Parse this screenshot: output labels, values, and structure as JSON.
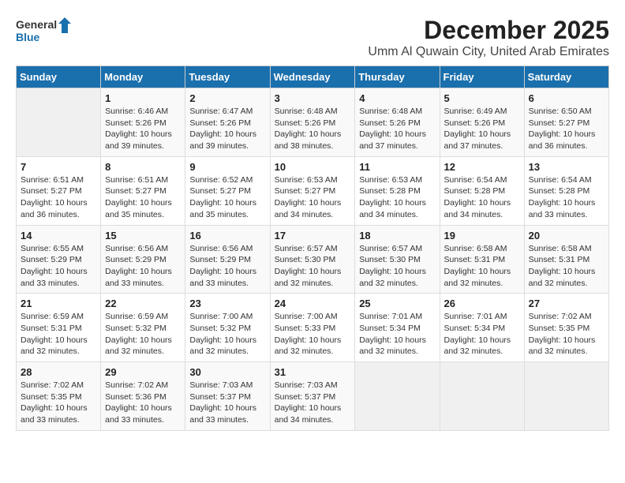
{
  "logo": {
    "general": "General",
    "blue": "Blue"
  },
  "title": "December 2025",
  "subtitle": "Umm Al Quwain City, United Arab Emirates",
  "weekdays": [
    "Sunday",
    "Monday",
    "Tuesday",
    "Wednesday",
    "Thursday",
    "Friday",
    "Saturday"
  ],
  "weeks": [
    [
      {
        "day": "",
        "info": ""
      },
      {
        "day": "1",
        "info": "Sunrise: 6:46 AM\nSunset: 5:26 PM\nDaylight: 10 hours\nand 39 minutes."
      },
      {
        "day": "2",
        "info": "Sunrise: 6:47 AM\nSunset: 5:26 PM\nDaylight: 10 hours\nand 39 minutes."
      },
      {
        "day": "3",
        "info": "Sunrise: 6:48 AM\nSunset: 5:26 PM\nDaylight: 10 hours\nand 38 minutes."
      },
      {
        "day": "4",
        "info": "Sunrise: 6:48 AM\nSunset: 5:26 PM\nDaylight: 10 hours\nand 37 minutes."
      },
      {
        "day": "5",
        "info": "Sunrise: 6:49 AM\nSunset: 5:26 PM\nDaylight: 10 hours\nand 37 minutes."
      },
      {
        "day": "6",
        "info": "Sunrise: 6:50 AM\nSunset: 5:27 PM\nDaylight: 10 hours\nand 36 minutes."
      }
    ],
    [
      {
        "day": "7",
        "info": "Sunrise: 6:51 AM\nSunset: 5:27 PM\nDaylight: 10 hours\nand 36 minutes."
      },
      {
        "day": "8",
        "info": "Sunrise: 6:51 AM\nSunset: 5:27 PM\nDaylight: 10 hours\nand 35 minutes."
      },
      {
        "day": "9",
        "info": "Sunrise: 6:52 AM\nSunset: 5:27 PM\nDaylight: 10 hours\nand 35 minutes."
      },
      {
        "day": "10",
        "info": "Sunrise: 6:53 AM\nSunset: 5:27 PM\nDaylight: 10 hours\nand 34 minutes."
      },
      {
        "day": "11",
        "info": "Sunrise: 6:53 AM\nSunset: 5:28 PM\nDaylight: 10 hours\nand 34 minutes."
      },
      {
        "day": "12",
        "info": "Sunrise: 6:54 AM\nSunset: 5:28 PM\nDaylight: 10 hours\nand 34 minutes."
      },
      {
        "day": "13",
        "info": "Sunrise: 6:54 AM\nSunset: 5:28 PM\nDaylight: 10 hours\nand 33 minutes."
      }
    ],
    [
      {
        "day": "14",
        "info": "Sunrise: 6:55 AM\nSunset: 5:29 PM\nDaylight: 10 hours\nand 33 minutes."
      },
      {
        "day": "15",
        "info": "Sunrise: 6:56 AM\nSunset: 5:29 PM\nDaylight: 10 hours\nand 33 minutes."
      },
      {
        "day": "16",
        "info": "Sunrise: 6:56 AM\nSunset: 5:29 PM\nDaylight: 10 hours\nand 33 minutes."
      },
      {
        "day": "17",
        "info": "Sunrise: 6:57 AM\nSunset: 5:30 PM\nDaylight: 10 hours\nand 32 minutes."
      },
      {
        "day": "18",
        "info": "Sunrise: 6:57 AM\nSunset: 5:30 PM\nDaylight: 10 hours\nand 32 minutes."
      },
      {
        "day": "19",
        "info": "Sunrise: 6:58 AM\nSunset: 5:31 PM\nDaylight: 10 hours\nand 32 minutes."
      },
      {
        "day": "20",
        "info": "Sunrise: 6:58 AM\nSunset: 5:31 PM\nDaylight: 10 hours\nand 32 minutes."
      }
    ],
    [
      {
        "day": "21",
        "info": "Sunrise: 6:59 AM\nSunset: 5:31 PM\nDaylight: 10 hours\nand 32 minutes."
      },
      {
        "day": "22",
        "info": "Sunrise: 6:59 AM\nSunset: 5:32 PM\nDaylight: 10 hours\nand 32 minutes."
      },
      {
        "day": "23",
        "info": "Sunrise: 7:00 AM\nSunset: 5:32 PM\nDaylight: 10 hours\nand 32 minutes."
      },
      {
        "day": "24",
        "info": "Sunrise: 7:00 AM\nSunset: 5:33 PM\nDaylight: 10 hours\nand 32 minutes."
      },
      {
        "day": "25",
        "info": "Sunrise: 7:01 AM\nSunset: 5:34 PM\nDaylight: 10 hours\nand 32 minutes."
      },
      {
        "day": "26",
        "info": "Sunrise: 7:01 AM\nSunset: 5:34 PM\nDaylight: 10 hours\nand 32 minutes."
      },
      {
        "day": "27",
        "info": "Sunrise: 7:02 AM\nSunset: 5:35 PM\nDaylight: 10 hours\nand 32 minutes."
      }
    ],
    [
      {
        "day": "28",
        "info": "Sunrise: 7:02 AM\nSunset: 5:35 PM\nDaylight: 10 hours\nand 33 minutes."
      },
      {
        "day": "29",
        "info": "Sunrise: 7:02 AM\nSunset: 5:36 PM\nDaylight: 10 hours\nand 33 minutes."
      },
      {
        "day": "30",
        "info": "Sunrise: 7:03 AM\nSunset: 5:37 PM\nDaylight: 10 hours\nand 33 minutes."
      },
      {
        "day": "31",
        "info": "Sunrise: 7:03 AM\nSunset: 5:37 PM\nDaylight: 10 hours\nand 34 minutes."
      },
      {
        "day": "",
        "info": ""
      },
      {
        "day": "",
        "info": ""
      },
      {
        "day": "",
        "info": ""
      }
    ]
  ]
}
